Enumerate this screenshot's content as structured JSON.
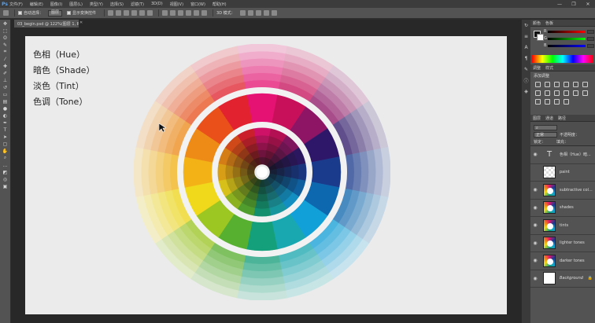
{
  "app": {
    "logo": "Ps"
  },
  "menubar": {
    "items": [
      "文件(F)",
      "编辑(E)",
      "图像(I)",
      "图层(L)",
      "类型(Y)",
      "选择(S)",
      "滤镜(T)",
      "3D(D)",
      "视图(V)",
      "窗口(W)",
      "帮助(H)"
    ],
    "window_controls": [
      "—",
      "❐",
      "✕"
    ]
  },
  "optionsbar": {
    "auto_select_label": "自动选择：",
    "auto_select_value": "图层",
    "show_transform_label": "显示变换控件",
    "mode_3d_label": "3D 模式："
  },
  "document": {
    "tab_title": "03_begin.psd @ 122%(图层 1, RGB/8) *",
    "labels": [
      "色相（Hue）",
      "暗色（Shade）",
      "淡色（Tint）",
      "色调（Tone）"
    ]
  },
  "panels": {
    "color_tabs": [
      "颜色",
      "色板"
    ],
    "sliders": [
      {
        "label": "R",
        "gradient": "linear-gradient(90deg,#000,#f00)"
      },
      {
        "label": "G",
        "gradient": "linear-gradient(90deg,#000,#0f0)"
      },
      {
        "label": "B",
        "gradient": "linear-gradient(90deg,#000,#00f)"
      }
    ],
    "adjust_tabs": [
      "调整",
      "样式"
    ],
    "adjust_title": "添加调整",
    "layers_tabs": [
      "图层",
      "通道",
      "路径"
    ],
    "blend_mode": "正常",
    "opacity_label": "不透明度：",
    "fill_label": "填充：",
    "lock_label": "锁定：",
    "layers": [
      {
        "name": "色相（Hue）暗...",
        "thumb": "text",
        "visible": true
      },
      {
        "name": "paint",
        "thumb": "checker",
        "visible": false
      },
      {
        "name": "subtractive col...",
        "thumb": "ring",
        "visible": true
      },
      {
        "name": "shades",
        "thumb": "ring",
        "visible": true
      },
      {
        "name": "tints",
        "thumb": "ring",
        "visible": true
      },
      {
        "name": "lighter tones",
        "thumb": "ring",
        "visible": true
      },
      {
        "name": "darker tones",
        "thumb": "ring",
        "visible": true
      },
      {
        "name": "Background",
        "thumb": "white",
        "visible": true
      }
    ]
  },
  "wheel": {
    "hues": [
      "#e61273",
      "#c8105a",
      "#8e1566",
      "#2e1769",
      "#1a3a8c",
      "#0e68b0",
      "#12a0d8",
      "#19a8b0",
      "#14a07a",
      "#58b030",
      "#9cc622",
      "#f0d81a",
      "#f3b216",
      "#ee8a16",
      "#e9501a",
      "#e2222e"
    ]
  },
  "colors": {
    "canvas": "#ebebeb",
    "panel": "#535353",
    "accent": "#4aa3ff"
  }
}
